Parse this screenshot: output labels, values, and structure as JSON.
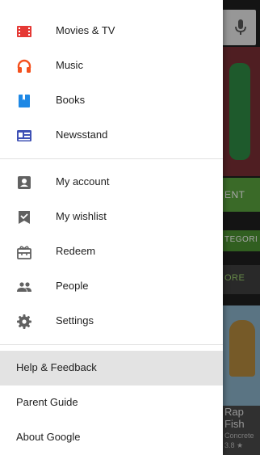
{
  "drawer": {
    "content_items": [
      {
        "label": "Movies & TV",
        "icon": "movies-tv-icon",
        "color": "#e53935"
      },
      {
        "label": "Music",
        "icon": "headphones-icon",
        "color": "#f4511e"
      },
      {
        "label": "Books",
        "icon": "book-icon",
        "color": "#1e88e5"
      },
      {
        "label": "Newsstand",
        "icon": "newsstand-icon",
        "color": "#3f51b5"
      }
    ],
    "account_items": [
      {
        "label": "My account",
        "icon": "account-icon"
      },
      {
        "label": "My wishlist",
        "icon": "wishlist-icon"
      },
      {
        "label": "Redeem",
        "icon": "gift-icon"
      },
      {
        "label": "People",
        "icon": "people-icon"
      },
      {
        "label": "Settings",
        "icon": "gear-icon"
      }
    ],
    "footer_items": [
      {
        "label": "Help & Feedback"
      },
      {
        "label": "Parent Guide"
      },
      {
        "label": "About Google"
      }
    ],
    "icon_gray": "#616161",
    "selected_bg": "#e3e3e3"
  },
  "background": {
    "banner_text": "ENT",
    "category_text": "TEGORI",
    "more_text": "ORE",
    "card_title": "Rap Fish",
    "card_developer": "Concrete",
    "card_rating": "3.8 ★",
    "mic_icon": "mic-icon"
  }
}
